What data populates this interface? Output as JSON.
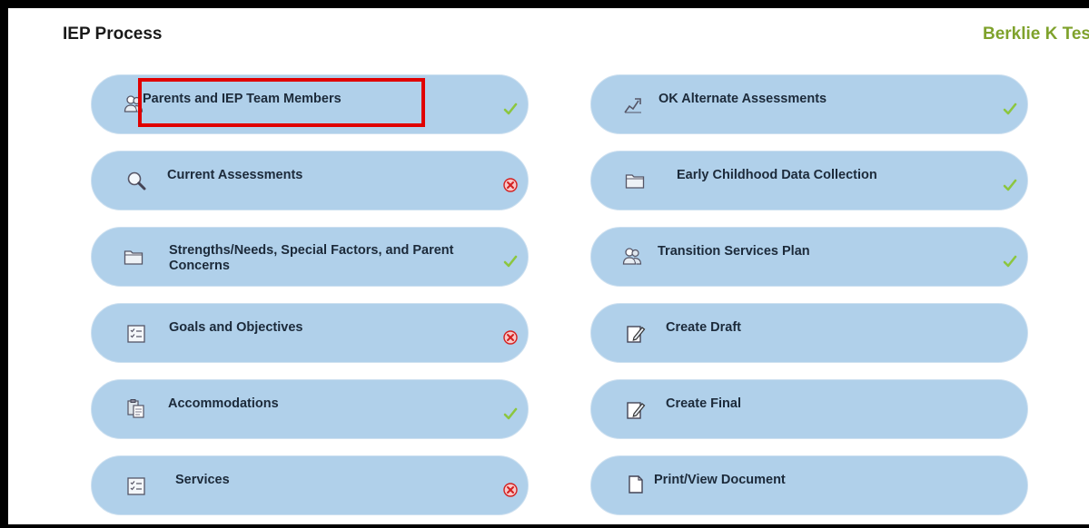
{
  "header": {
    "title": "IEP Process",
    "student_name": "Berklie K Tes"
  },
  "colors": {
    "pill_bg": "#b0d0ea",
    "student_name": "#7fa22c",
    "check": "#8cc63f",
    "error": "#d42020",
    "highlight": "#e00000"
  },
  "steps": [
    {
      "label": "Parents and IEP Team Members",
      "icon": "people-icon",
      "status": "complete"
    },
    {
      "label": "Current Assessments",
      "icon": "magnifier-icon",
      "status": "incomplete"
    },
    {
      "label": "Strengths/Needs, Special Factors, and Parent Concerns",
      "icon": "folder-icon",
      "status": "complete"
    },
    {
      "label": "Goals and Objectives",
      "icon": "checklist-icon",
      "status": "incomplete"
    },
    {
      "label": "Accommodations",
      "icon": "clipboard-icon",
      "status": "complete"
    },
    {
      "label": "Services",
      "icon": "checklist-icon",
      "status": "incomplete"
    },
    {
      "label": "OK Alternate Assessments",
      "icon": "chart-arrow-icon",
      "status": "complete"
    },
    {
      "label": "Early Childhood Data Collection",
      "icon": "folder-icon",
      "status": "complete"
    },
    {
      "label": "Transition Services Plan",
      "icon": "people-icon",
      "status": "complete"
    },
    {
      "label": "Create Draft",
      "icon": "document-edit-icon",
      "status": "none"
    },
    {
      "label": "Create Final",
      "icon": "document-edit-icon",
      "status": "none"
    },
    {
      "label": "Print/View Document",
      "icon": "document-icon",
      "status": "none"
    }
  ]
}
